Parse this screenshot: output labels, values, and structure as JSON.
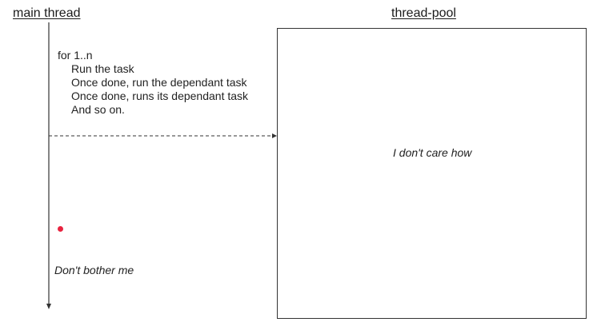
{
  "main_thread": {
    "heading": "main thread",
    "loop_line": "for 1..n",
    "steps": [
      "Run the task",
      "Once done, run the dependant task",
      "Once done, runs its dependant task",
      "And so on."
    ],
    "note": "Don't bother me"
  },
  "thread_pool": {
    "heading": "thread-pool",
    "note": "I don't care how"
  },
  "colors": {
    "line": "#333333",
    "dot": "#e8233f"
  }
}
